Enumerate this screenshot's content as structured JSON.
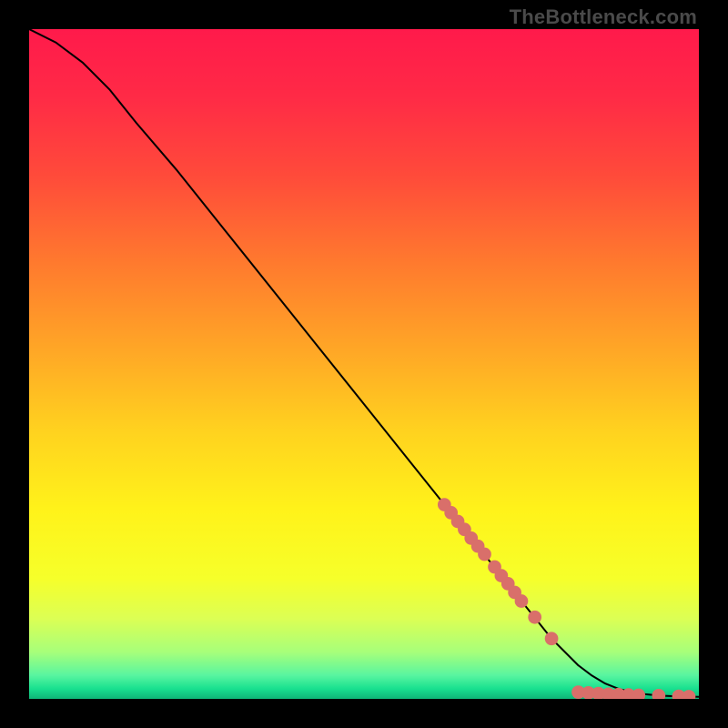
{
  "attribution": "TheBottleneck.com",
  "colors": {
    "gradient_stops": [
      {
        "offset": 0.0,
        "color": "#ff1a4b"
      },
      {
        "offset": 0.1,
        "color": "#ff2a46"
      },
      {
        "offset": 0.22,
        "color": "#ff4b3a"
      },
      {
        "offset": 0.35,
        "color": "#ff7a2e"
      },
      {
        "offset": 0.48,
        "color": "#ffa726"
      },
      {
        "offset": 0.6,
        "color": "#ffd21f"
      },
      {
        "offset": 0.72,
        "color": "#fff31a"
      },
      {
        "offset": 0.82,
        "color": "#f6ff2a"
      },
      {
        "offset": 0.88,
        "color": "#dcff54"
      },
      {
        "offset": 0.93,
        "color": "#a7ff7a"
      },
      {
        "offset": 0.965,
        "color": "#58f5a0"
      },
      {
        "offset": 0.985,
        "color": "#18e08f"
      },
      {
        "offset": 1.0,
        "color": "#0fb577"
      }
    ],
    "curve": "#000000",
    "marker": "#d96f6a",
    "page_bg": "#000000"
  },
  "chart_data": {
    "type": "line",
    "xlabel": "",
    "ylabel": "",
    "xlim": [
      0,
      100
    ],
    "ylim": [
      0,
      100
    ],
    "note": "Axes are unlabeled; values are normalized 0–100 estimated from plot position.",
    "series": [
      {
        "name": "curve",
        "x": [
          0,
          4,
          8,
          12,
          16,
          22,
          30,
          40,
          50,
          60,
          68,
          74,
          78,
          82,
          84,
          86,
          88,
          90,
          92,
          94,
          96,
          98,
          100
        ],
        "y": [
          100,
          98,
          95,
          91,
          86,
          79,
          69,
          56.5,
          44,
          31.5,
          21.5,
          14,
          9,
          5,
          3.5,
          2.3,
          1.5,
          1.0,
          0.7,
          0.5,
          0.4,
          0.35,
          0.3
        ]
      }
    ],
    "markers": {
      "name": "highlighted-points",
      "comment": "Salmon dots clustered on the descending tail of the curve",
      "points": [
        {
          "x": 62,
          "y": 29
        },
        {
          "x": 63,
          "y": 27.8
        },
        {
          "x": 64,
          "y": 26.5
        },
        {
          "x": 65,
          "y": 25.3
        },
        {
          "x": 66,
          "y": 24
        },
        {
          "x": 67,
          "y": 22.8
        },
        {
          "x": 68,
          "y": 21.6
        },
        {
          "x": 69.5,
          "y": 19.7
        },
        {
          "x": 70.5,
          "y": 18.4
        },
        {
          "x": 71.5,
          "y": 17.2
        },
        {
          "x": 72.5,
          "y": 15.9
        },
        {
          "x": 73.5,
          "y": 14.6
        },
        {
          "x": 75.5,
          "y": 12.2
        },
        {
          "x": 78,
          "y": 9.0
        },
        {
          "x": 82,
          "y": 1.0
        },
        {
          "x": 83.5,
          "y": 0.9
        },
        {
          "x": 85,
          "y": 0.8
        },
        {
          "x": 86.5,
          "y": 0.7
        },
        {
          "x": 88,
          "y": 0.65
        },
        {
          "x": 89.5,
          "y": 0.6
        },
        {
          "x": 91,
          "y": 0.55
        },
        {
          "x": 94,
          "y": 0.5
        },
        {
          "x": 97,
          "y": 0.4
        },
        {
          "x": 98.5,
          "y": 0.35
        }
      ]
    }
  }
}
